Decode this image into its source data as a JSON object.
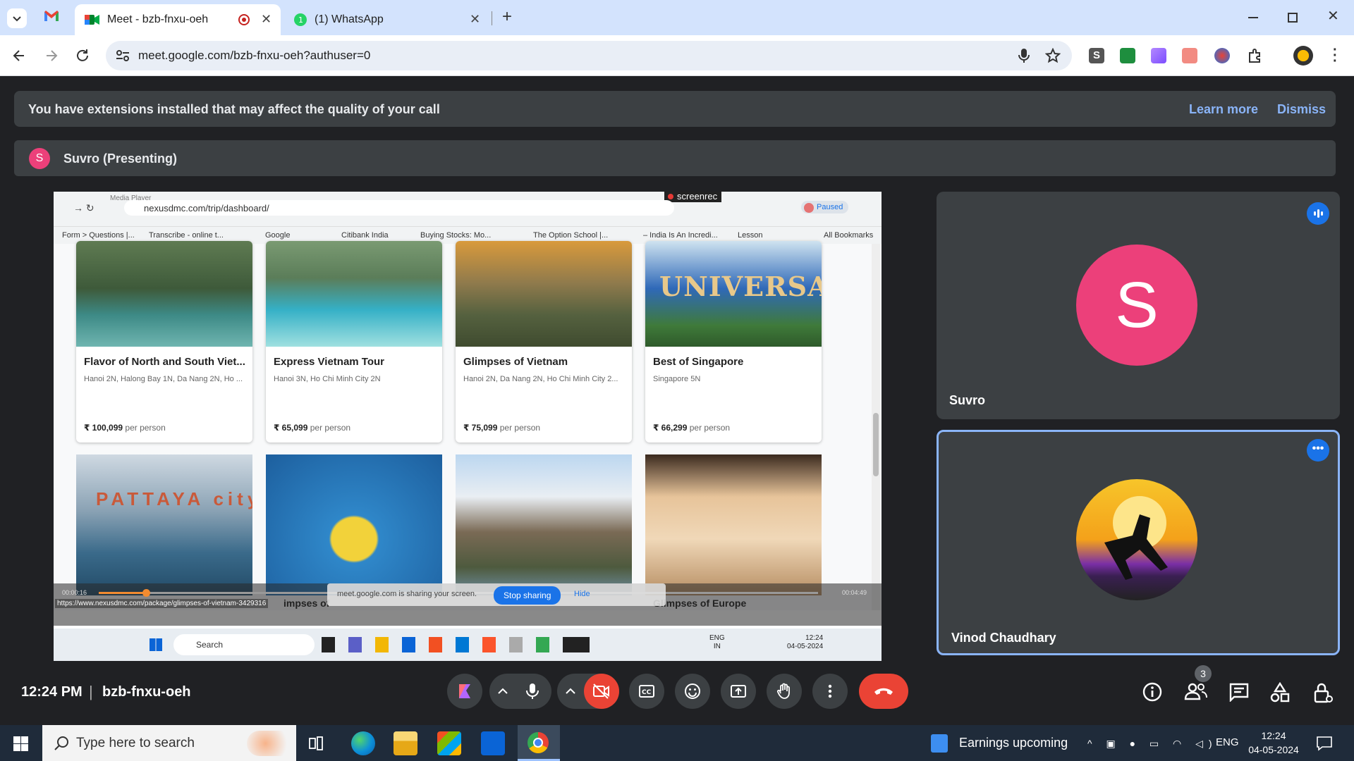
{
  "browser": {
    "tabs": [
      {
        "label": "Meet - bzb-fnxu-oeh",
        "icon": "google-meet-icon",
        "recording": true
      },
      {
        "label": "(1) WhatsApp",
        "icon": "whatsapp-icon"
      }
    ],
    "url": "meet.google.com/bzb-fnxu-oeh?authuser=0"
  },
  "banner": {
    "message": "You have extensions installed that may affect the quality of your call",
    "learn_more": "Learn more",
    "dismiss": "Dismiss"
  },
  "presenter": {
    "initial": "S",
    "label": "Suvro (Presenting)"
  },
  "shared_screen": {
    "recorder_label": "screenrec",
    "media_label": "Media Player",
    "url": "nexusdmc.com/trip/dashboard/",
    "paused_label": "Paused",
    "bookmarks": [
      "Form > Questions |...",
      "Transcribe - online t...",
      "Google",
      "Citibank India",
      "Buying Stocks: Mo...",
      "The Option School |...",
      "– India Is An Incredi...",
      "Lesson",
      "All Bookmarks"
    ],
    "cards": [
      {
        "title": "Flavor of North and South Viet...",
        "subtitle": "Hanoi 2N, Halong Bay 1N, Da Nang 2N, Ho ...",
        "price": "₹ 100,099",
        "per": "per person"
      },
      {
        "title": "Express Vietnam Tour",
        "subtitle": "Hanoi 3N, Ho Chi Minh City 2N",
        "price": "₹ 65,099",
        "per": "per person"
      },
      {
        "title": "Glimpses of Vietnam",
        "subtitle": "Hanoi 2N, Da Nang 2N, Ho Chi Minh City 2...",
        "price": "₹ 75,099",
        "per": "per person"
      },
      {
        "title": "Best of Singapore",
        "subtitle": "Singapore 5N",
        "price": "₹ 66,299",
        "per": "per person"
      }
    ],
    "row2_labels": [
      "impses of",
      "Glimpses of Europe"
    ],
    "pattaya_text": "PATTAYA city",
    "universal_text": "UNIVERSAL",
    "sharing_text": "meet.google.com is sharing your screen.",
    "stop_sharing": "Stop sharing",
    "hide": "Hide",
    "time_start": "00:00:16",
    "time_end": "00:04:49",
    "status_url": "https://www.nexusdmc.com/package/glimpses-of-vietnam-3429316",
    "inner_taskbar": {
      "search": "Search",
      "lang1": "ENG",
      "lang2": "IN",
      "time": "12:24",
      "date": "04-05-2024"
    }
  },
  "participants": [
    {
      "name": "Suvro",
      "initial": "S",
      "avatar_color": "#ec407a",
      "speaking": false
    },
    {
      "name": "Vinod Chaudhary",
      "initial": "",
      "speaking": true
    }
  ],
  "bottom_bar": {
    "time": "12:24 PM",
    "separator": "|",
    "meeting_code": "bzb-fnxu-oeh",
    "people_count": "3"
  },
  "taskbar": {
    "search_placeholder": "Type here to search",
    "earnings": "Earnings upcoming",
    "lang": "ENG",
    "time": "12:24",
    "date": "04-05-2024"
  },
  "colors": {
    "meet_bg": "#202124",
    "tile_bg": "#3c4043",
    "end_call": "#ea4335",
    "accent_blue": "#8ab4f8"
  }
}
